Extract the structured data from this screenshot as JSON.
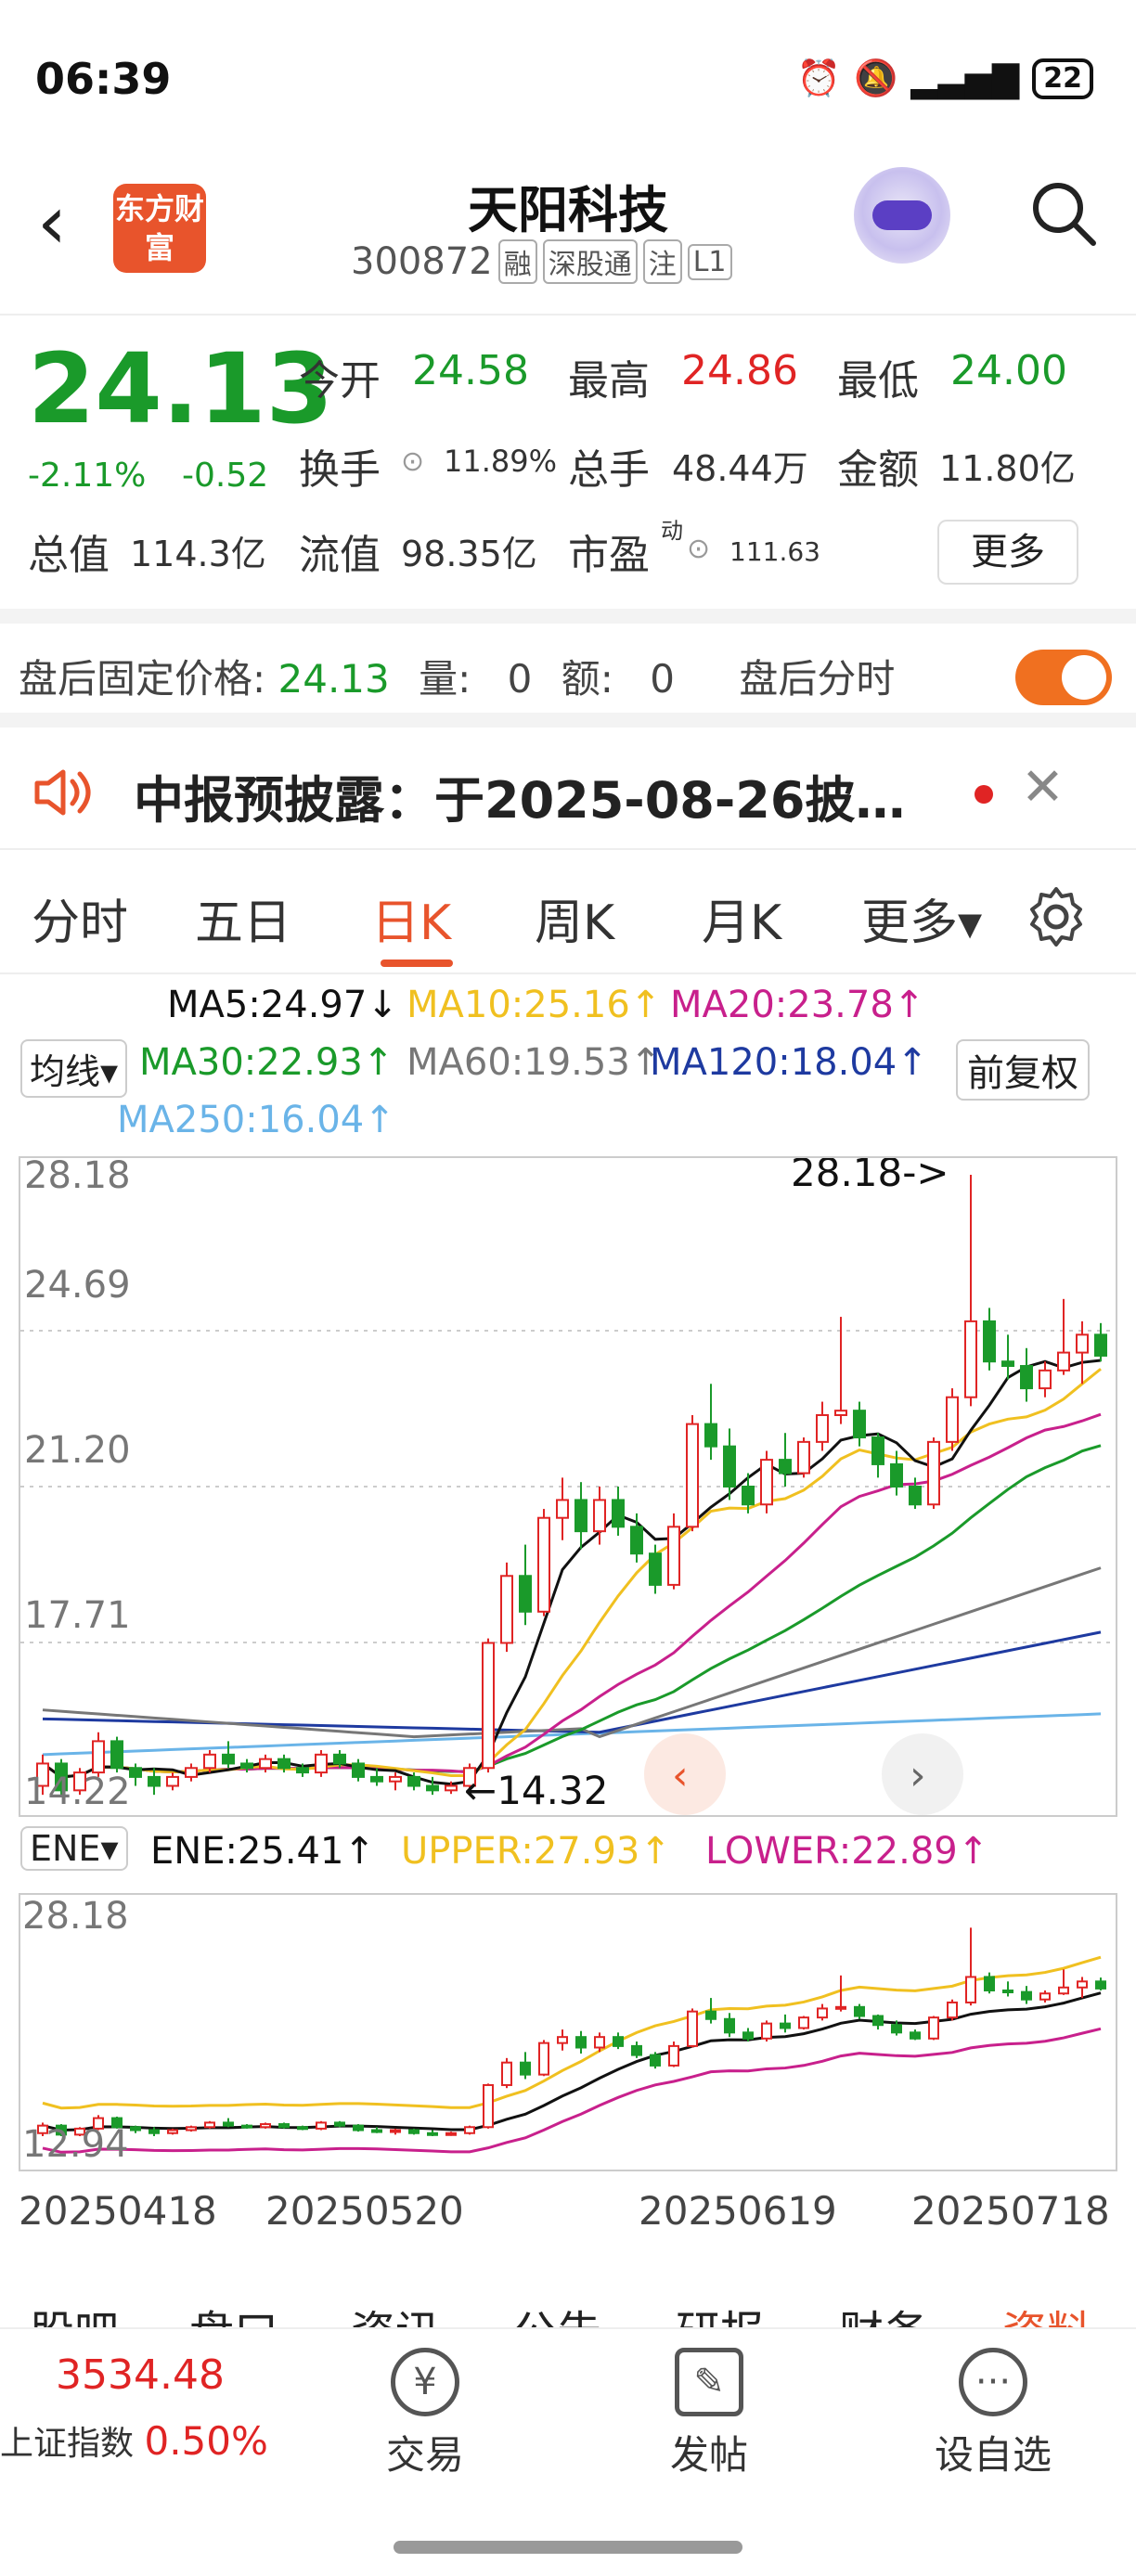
{
  "status": {
    "time": "06:39",
    "battery": "22"
  },
  "header": {
    "logo_text": "东方财富",
    "name": "天阳科技",
    "code": "300872",
    "tags": [
      "融",
      "深股通",
      "注",
      "L1"
    ]
  },
  "quote": {
    "price": "24.13",
    "change_pct": "-2.11%",
    "change": "-0.52",
    "open_label": "今开",
    "open": "24.58",
    "high_label": "最高",
    "high": "24.86",
    "low_label": "最低",
    "low": "24.00",
    "turnover_label": "换手",
    "turnover": "11.89%",
    "volume_label": "总手",
    "volume": "48.44万",
    "amount_label": "金额",
    "amount": "11.80亿",
    "mktcap_label": "总值",
    "mktcap": "114.3亿",
    "float_label": "流值",
    "float": "98.35亿",
    "pe_label": "市盈",
    "pe_sup": "动",
    "pe": "111.63",
    "more_label": "更多"
  },
  "after_hours": {
    "label": "盘后固定价格:",
    "price": "24.13",
    "vol_label": "量:",
    "vol": "0",
    "amt_label": "额:",
    "amt": "0",
    "toggle_label": "盘后分时"
  },
  "notice": {
    "text": "中报预披露：于2025-08-26披…"
  },
  "tabs": [
    "分时",
    "五日",
    "日K",
    "周K",
    "月K",
    "更多▾"
  ],
  "ma_legend": {
    "ma5": "MA5:24.97↓",
    "ma10": "MA10:25.16↑",
    "ma20": "MA20:23.78↑",
    "ma30": "MA30:22.93↑",
    "ma60": "MA60:19.53↑",
    "ma120": "MA120:18.04↑",
    "ma250": "MA250:16.04↑",
    "juxian": "均线▾",
    "fuquan": "前复权"
  },
  "colors": {
    "up": "#e02424",
    "down": "#1a9a2a",
    "ma5": "#111111",
    "ma10": "#f0c020",
    "ma20": "#c8208c",
    "ma30": "#1a9a2a",
    "ma60": "#777777",
    "ma120": "#1e3aa0",
    "ma250": "#6ab4e8"
  },
  "kchart": {
    "y_labels": [
      "28.18",
      "24.69",
      "21.20",
      "17.71",
      "14.22"
    ],
    "max_annot": "28.18->",
    "min_annot": "←14.32"
  },
  "ene_legend": {
    "selector": "ENE▾",
    "ene": "ENE:25.41↑",
    "upper": "UPPER:27.93↑",
    "lower": "LOWER:22.89↑"
  },
  "enechart": {
    "y_top": "28.18",
    "y_bottom": "12.94"
  },
  "dates": [
    "20250418",
    "20250520",
    "20250619",
    "20250718"
  ],
  "bottom_tabs": [
    "股吧",
    "盘口",
    "资讯",
    "公告",
    "研报",
    "财务",
    "资料"
  ],
  "bottom_bar": {
    "index_value": "3534.48",
    "index_name": "上证指数",
    "index_change": "0.50%",
    "trade": "交易",
    "post": "发帖",
    "watch": "设自选"
  },
  "chart_data": {
    "type": "candlestick",
    "y_range": [
      14.22,
      28.18
    ],
    "candles": [
      [
        14.5,
        15.2,
        14.3,
        15.0
      ],
      [
        15.0,
        15.1,
        14.3,
        14.4
      ],
      [
        14.4,
        14.9,
        14.3,
        14.8
      ],
      [
        14.8,
        15.7,
        14.7,
        15.5
      ],
      [
        15.5,
        15.6,
        14.8,
        14.9
      ],
      [
        14.9,
        15.0,
        14.5,
        14.7
      ],
      [
        14.7,
        14.9,
        14.3,
        14.5
      ],
      [
        14.5,
        14.8,
        14.4,
        14.7
      ],
      [
        14.7,
        15.0,
        14.6,
        14.9
      ],
      [
        14.9,
        15.3,
        14.8,
        15.2
      ],
      [
        15.2,
        15.5,
        14.9,
        15.0
      ],
      [
        15.0,
        15.1,
        14.8,
        14.9
      ],
      [
        14.9,
        15.2,
        14.8,
        15.1
      ],
      [
        15.1,
        15.2,
        14.8,
        14.9
      ],
      [
        14.9,
        15.0,
        14.7,
        14.8
      ],
      [
        14.8,
        15.3,
        14.7,
        15.2
      ],
      [
        15.2,
        15.3,
        14.9,
        15.0
      ],
      [
        15.0,
        15.1,
        14.6,
        14.7
      ],
      [
        14.7,
        14.9,
        14.5,
        14.6
      ],
      [
        14.6,
        14.8,
        14.4,
        14.7
      ],
      [
        14.7,
        14.8,
        14.4,
        14.5
      ],
      [
        14.5,
        14.7,
        14.3,
        14.4
      ],
      [
        14.4,
        14.6,
        14.32,
        14.5
      ],
      [
        14.5,
        15.0,
        14.4,
        14.9
      ],
      [
        14.9,
        17.8,
        14.8,
        17.7
      ],
      [
        17.7,
        19.5,
        17.5,
        19.2
      ],
      [
        19.2,
        19.9,
        18.1,
        18.4
      ],
      [
        18.4,
        20.7,
        18.3,
        20.5
      ],
      [
        20.5,
        21.4,
        20.0,
        20.9
      ],
      [
        20.9,
        21.3,
        19.8,
        20.2
      ],
      [
        20.2,
        21.2,
        19.9,
        20.9
      ],
      [
        20.9,
        21.2,
        20.1,
        20.3
      ],
      [
        20.3,
        20.6,
        19.5,
        19.7
      ],
      [
        19.7,
        19.9,
        18.8,
        19.0
      ],
      [
        19.0,
        20.6,
        18.9,
        20.3
      ],
      [
        20.3,
        22.8,
        20.2,
        22.6
      ],
      [
        22.6,
        23.5,
        21.8,
        22.1
      ],
      [
        22.1,
        22.5,
        20.9,
        21.2
      ],
      [
        21.2,
        21.5,
        20.6,
        20.8
      ],
      [
        20.8,
        22.0,
        20.6,
        21.8
      ],
      [
        21.8,
        22.4,
        21.2,
        21.5
      ],
      [
        21.5,
        22.3,
        21.4,
        22.2
      ],
      [
        22.2,
        23.1,
        22.0,
        22.8
      ],
      [
        22.8,
        25.0,
        22.6,
        22.9
      ],
      [
        22.9,
        23.1,
        22.1,
        22.3
      ],
      [
        22.3,
        22.4,
        21.4,
        21.7
      ],
      [
        21.7,
        22.0,
        21.0,
        21.2
      ],
      [
        21.2,
        21.4,
        20.7,
        20.8
      ],
      [
        20.8,
        22.3,
        20.7,
        22.2
      ],
      [
        22.2,
        23.4,
        22.0,
        23.2
      ],
      [
        23.2,
        28.18,
        23.0,
        24.9
      ],
      [
        24.9,
        25.2,
        23.8,
        24.0
      ],
      [
        24.0,
        24.6,
        23.6,
        23.9
      ],
      [
        23.9,
        24.3,
        23.1,
        23.4
      ],
      [
        23.4,
        24.0,
        23.2,
        23.8
      ],
      [
        23.8,
        25.4,
        23.7,
        24.2
      ],
      [
        24.2,
        24.9,
        23.5,
        24.6
      ],
      [
        24.6,
        24.86,
        24.0,
        24.13
      ]
    ]
  }
}
